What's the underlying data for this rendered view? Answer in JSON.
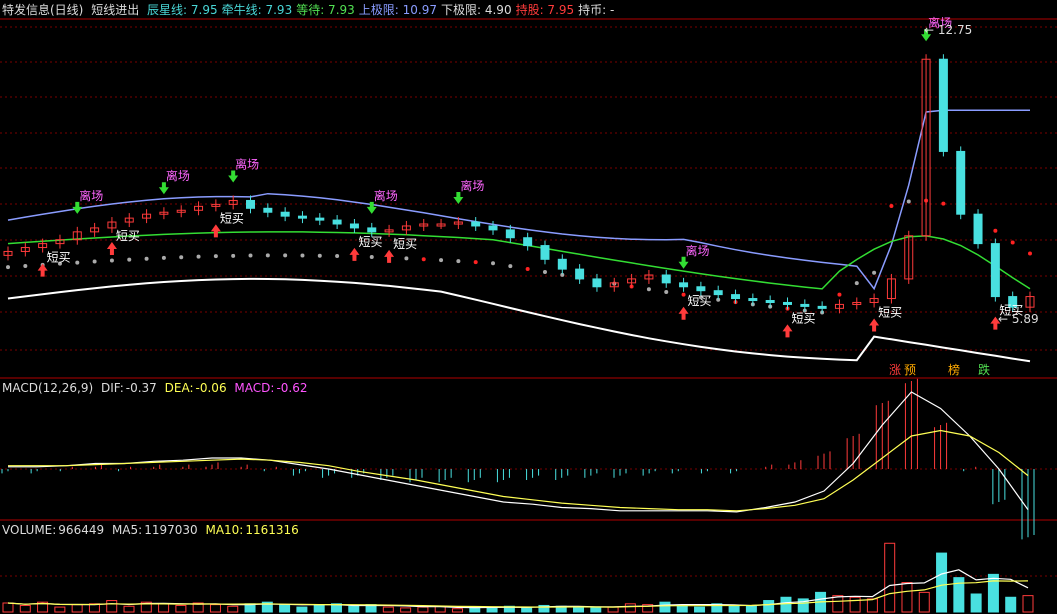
{
  "main_header": {
    "title": "特发信息(日线)",
    "indicator": "短线进出",
    "items": [
      {
        "label": "辰星线:",
        "value": "7.95",
        "color": "#49d6d6"
      },
      {
        "label": "牵牛线:",
        "value": "7.93",
        "color": "#49d6d6"
      },
      {
        "label": "等待:",
        "value": "7.93",
        "color": "#52e052"
      },
      {
        "label": "上极限:",
        "value": "10.97",
        "color": "#8a9cff"
      },
      {
        "label": "下极限:",
        "value": "4.90",
        "color": "#dcdcdc"
      },
      {
        "label": "持股:",
        "value": "7.95",
        "color": "#ff3b3b"
      },
      {
        "label": "持币:",
        "value": "-",
        "color": "#dcdcdc"
      }
    ]
  },
  "macd_header": {
    "title": "MACD(12,26,9)",
    "dif_label": "DIF:",
    "dif_value": "-0.37",
    "dea_label": "DEA:",
    "dea_value": "-0.06",
    "macd_label": "MACD:",
    "macd_value": "-0.62"
  },
  "volume_header": {
    "title": "VOLUME:",
    "value": "966449",
    "ma5_label": "MA5:",
    "ma5_value": "1197030",
    "ma10_label": "MA10:",
    "ma10_value": "1161316"
  },
  "annotations": {
    "high_price": "12.75",
    "low_price": "5.89",
    "buy_label": "短买",
    "exit_label": "离场",
    "tags": [
      {
        "text": "涨",
        "color": "#ff3b3b"
      },
      {
        "text": "预",
        "color": "#ffaa00"
      },
      {
        "text": "榜",
        "color": "#ffaa00"
      },
      {
        "text": "跌",
        "color": "#52e052"
      }
    ]
  },
  "colors": {
    "up": "#ff3b3b",
    "down": "#49e0e0",
    "upper_band": "#8a9cff",
    "lower_band": "#ffffff",
    "wait_line": "#33dd33",
    "dot_gray": "#aaaaaa",
    "dot_red": "#ff2222",
    "grid": "#7a0000",
    "separator": "#b00000"
  },
  "chart_data": {
    "type": "candlestick",
    "ylim": [
      4.2,
      13.3
    ],
    "closes": [
      7.4,
      7.5,
      7.6,
      7.7,
      7.9,
      8.0,
      8.15,
      8.25,
      8.35,
      8.4,
      8.45,
      8.55,
      8.6,
      8.7,
      8.5,
      8.4,
      8.3,
      8.25,
      8.2,
      8.1,
      8.0,
      7.9,
      7.95,
      8.05,
      8.1,
      8.1,
      8.15,
      8.05,
      7.95,
      7.75,
      7.55,
      7.2,
      6.95,
      6.7,
      6.5,
      6.6,
      6.7,
      6.8,
      6.6,
      6.5,
      6.4,
      6.3,
      6.2,
      6.15,
      6.1,
      6.05,
      6.0,
      5.95,
      6.05,
      6.1,
      6.2,
      6.7,
      7.8,
      12.3,
      9.95,
      8.35,
      7.6,
      6.25,
      5.98,
      6.25
    ],
    "macd_dif": [
      0.02,
      0.02,
      0.03,
      0.05,
      0.05,
      0.07,
      0.08,
      0.1,
      0.1,
      0.08,
      0.04,
      0.0,
      -0.05,
      -0.1,
      -0.15,
      -0.2,
      -0.25,
      -0.3,
      -0.32,
      -0.35,
      -0.36,
      -0.38,
      -0.38,
      -0.38,
      -0.38,
      -0.39,
      -0.35,
      -0.3,
      -0.2,
      0.05,
      0.4,
      0.7,
      0.55,
      0.3,
      0.0,
      -0.37
    ],
    "macd_dea": [
      0.03,
      0.03,
      0.03,
      0.04,
      0.05,
      0.06,
      0.07,
      0.08,
      0.09,
      0.08,
      0.06,
      0.03,
      -0.02,
      -0.06,
      -0.1,
      -0.15,
      -0.2,
      -0.25,
      -0.28,
      -0.31,
      -0.33,
      -0.35,
      -0.36,
      -0.37,
      -0.37,
      -0.38,
      -0.36,
      -0.33,
      -0.27,
      -0.1,
      0.1,
      0.3,
      0.35,
      0.3,
      0.15,
      -0.06
    ],
    "volume": [
      0.55,
      0.4,
      0.6,
      0.3,
      0.45,
      0.5,
      0.7,
      0.35,
      0.6,
      0.5,
      0.4,
      0.55,
      0.45,
      0.35,
      0.5,
      0.6,
      0.45,
      0.3,
      0.4,
      0.5,
      0.35,
      0.45,
      0.3,
      0.25,
      0.3,
      0.35,
      0.2,
      0.25,
      0.3,
      0.35,
      0.3,
      0.4,
      0.35,
      0.3,
      0.25,
      0.3,
      0.5,
      0.45,
      0.6,
      0.4,
      0.3,
      0.5,
      0.4,
      0.35,
      0.7,
      0.9,
      0.8,
      1.2,
      1.0,
      0.9,
      0.8,
      4.2,
      1.8,
      1.2,
      3.6,
      2.1,
      1.1,
      2.3,
      0.9,
      1.0
    ]
  }
}
